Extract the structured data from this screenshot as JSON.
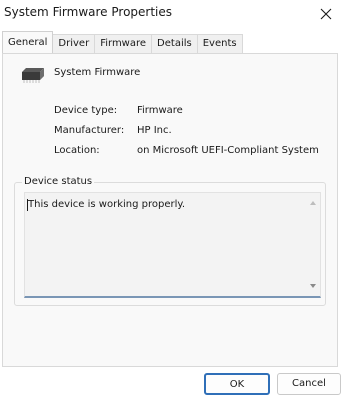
{
  "window": {
    "title": "System Firmware Properties",
    "close_icon": "close-icon"
  },
  "tabs": [
    {
      "label": "General",
      "active": true
    },
    {
      "label": "Driver",
      "active": false
    },
    {
      "label": "Firmware",
      "active": false
    },
    {
      "label": "Details",
      "active": false
    },
    {
      "label": "Events",
      "active": false
    }
  ],
  "device": {
    "icon": "chip-icon",
    "name": "System Firmware"
  },
  "properties": [
    {
      "label": "Device type:",
      "value": "Firmware"
    },
    {
      "label": "Manufacturer:",
      "value": "HP Inc."
    },
    {
      "label": "Location:",
      "value": "on Microsoft UEFI-Compliant System"
    }
  ],
  "device_status": {
    "label": "Device status",
    "text": "This device is working properly."
  },
  "buttons": {
    "ok": "OK",
    "cancel": "Cancel"
  },
  "colors": {
    "ok_border": "#2f6fb8",
    "panel_background": "#f9f9f9",
    "status_underline": "#7a96b5"
  }
}
